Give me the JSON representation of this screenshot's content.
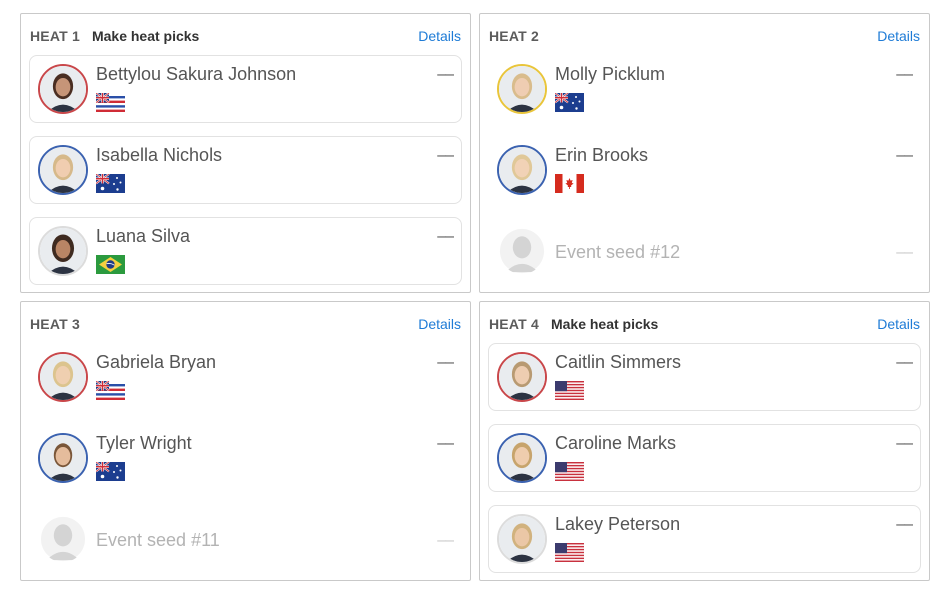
{
  "heats": [
    {
      "label": "HEAT 1",
      "cta": "Make heat picks",
      "details": "Details",
      "surfers": [
        {
          "name": "Bettylou Sakura Johnson",
          "flag": "hawaii-flag",
          "ring": "red",
          "score": "––"
        },
        {
          "name": "Isabella Nichols",
          "flag": "australia-flag",
          "ring": "blue",
          "score": "––"
        },
        {
          "name": "Luana Silva",
          "flag": "brazil-flag",
          "ring": "ghost",
          "score": "––"
        }
      ]
    },
    {
      "label": "HEAT 2",
      "cta": "",
      "details": "Details",
      "surfers": [
        {
          "name": "Molly Picklum",
          "flag": "australia-flag",
          "ring": "yellow",
          "score": "––"
        },
        {
          "name": "Erin Brooks",
          "flag": "canada-flag",
          "ring": "blue",
          "score": "––"
        },
        {
          "name": "Event seed #12",
          "flag": "",
          "ring": "ghost",
          "score": "––"
        }
      ]
    },
    {
      "label": "HEAT 3",
      "cta": "",
      "details": "Details",
      "surfers": [
        {
          "name": "Gabriela Bryan",
          "flag": "hawaii-flag",
          "ring": "red",
          "score": "––"
        },
        {
          "name": "Tyler Wright",
          "flag": "australia-flag",
          "ring": "blue",
          "score": "––"
        },
        {
          "name": "Event seed #11",
          "flag": "",
          "ring": "ghost",
          "score": "––"
        }
      ]
    },
    {
      "label": "HEAT 4",
      "cta": "Make heat picks",
      "details": "Details",
      "surfers": [
        {
          "name": "Caitlin Simmers",
          "flag": "usa-flag",
          "ring": "red",
          "score": "––"
        },
        {
          "name": "Caroline Marks",
          "flag": "usa-flag",
          "ring": "blue",
          "score": "––"
        },
        {
          "name": "Lakey Peterson",
          "flag": "usa-flag",
          "ring": "ghost",
          "score": "––"
        }
      ]
    }
  ],
  "colors": {
    "link": "#1e7bd6",
    "ring_red": "#c9474a",
    "ring_blue": "#3b62b0",
    "ring_yellow": "#e9c53a",
    "ring_ghost": "#dcdcdc"
  }
}
